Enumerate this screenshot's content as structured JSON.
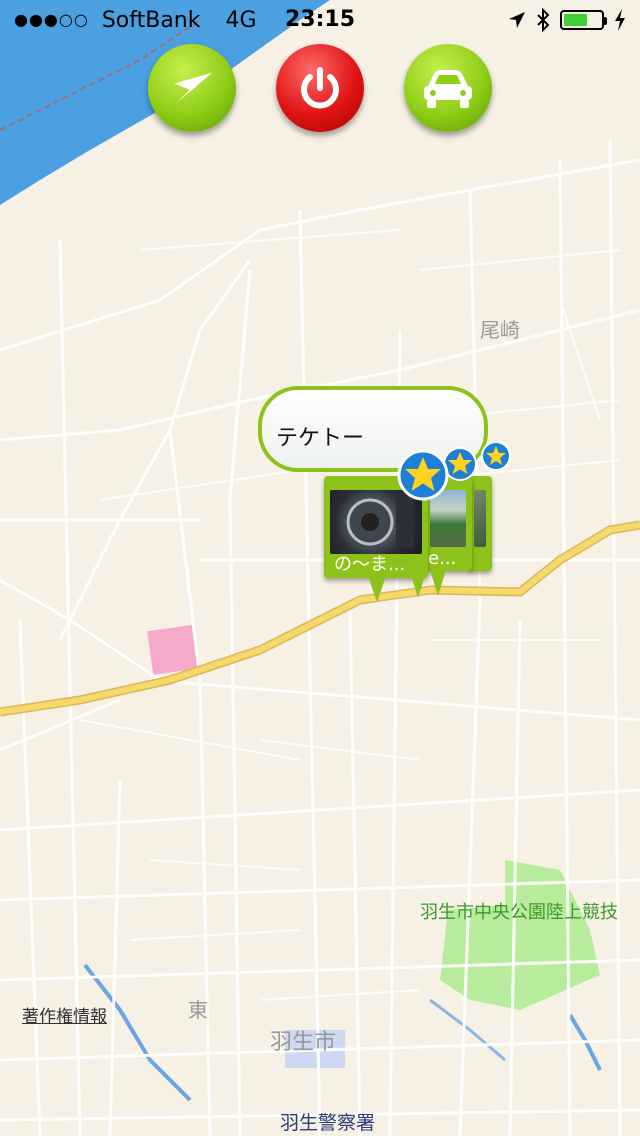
{
  "status_bar": {
    "signal": "●●●○○",
    "carrier": "SoftBank",
    "network": "4G",
    "time": "23:15"
  },
  "controls": {
    "locate_icon": "navigation-arrow-icon",
    "power_icon": "power-icon",
    "car_icon": "car-icon"
  },
  "callout": {
    "title": "テケトー"
  },
  "pins": [
    {
      "caption": "の〜ま..."
    },
    {
      "caption": "e..."
    },
    {
      "caption": ""
    }
  ],
  "map_labels": {
    "ozaki": "尾崎",
    "park": "羽生市中央公園陸上競技",
    "higashi": "東",
    "hanyu_city": "羽生市",
    "police": "羽生警察署",
    "copyright": "著作権情報"
  },
  "colors": {
    "accent_green": "#8cc21a",
    "power_red": "#e01414",
    "star_badge": "#1f7fd6",
    "road_major": "#f7d86a",
    "water": "#4aa0e0",
    "park": "#b7ec9c"
  }
}
